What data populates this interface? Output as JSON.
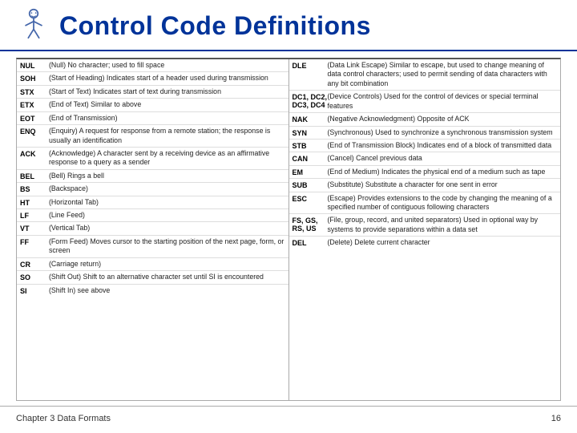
{
  "header": {
    "title": "Control Code Definitions",
    "icon_label": "stick-figure-icon"
  },
  "table": {
    "left_rows": [
      {
        "code": "NUL",
        "desc": "(Null) No character; used to fill space"
      },
      {
        "code": "SOH",
        "desc": "(Start of Heading) Indicates start of a header used during transmission"
      },
      {
        "code": "STX",
        "desc": "(Start of Text) Indicates start of text during transmission"
      },
      {
        "code": "ETX",
        "desc": "(End of Text) Similar to above"
      },
      {
        "code": "EOT",
        "desc": "(End of Transmission)"
      },
      {
        "code": "ENQ",
        "desc": "(Enquiry) A request for response from a remote station; the response is usually an identification"
      },
      {
        "code": "ACK",
        "desc": "(Acknowledge) A character sent by a receiving device as an affirmative response to a query as a sender"
      },
      {
        "code": "BEL",
        "desc": "(Bell) Rings a bell"
      },
      {
        "code": "BS",
        "desc": "(Backspace)"
      },
      {
        "code": "HT",
        "desc": "(Horizontal Tab)"
      },
      {
        "code": "LF",
        "desc": "(Line Feed)"
      },
      {
        "code": "VT",
        "desc": "(Vertical Tab)"
      },
      {
        "code": "FF",
        "desc": "(Form Feed) Moves cursor to the starting position of the next page, form, or screen"
      },
      {
        "code": "CR",
        "desc": "(Carriage return)"
      },
      {
        "code": "SO",
        "desc": "(Shift Out) Shift to an alternative character set until SI is encountered"
      },
      {
        "code": "SI",
        "desc": "(Shift In) see above"
      }
    ],
    "right_rows": [
      {
        "code": "DLE",
        "desc": "(Data Link Escape) Similar to escape, but used to change meaning of data control characters; used to permit sending of data characters with any bit combination"
      },
      {
        "code": "DC1, DC2,\nDC3, DC4",
        "desc": "(Device Controls) Used for the control of devices or special terminal features"
      },
      {
        "code": "NAK",
        "desc": "(Negative Acknowledgment) Opposite of ACK"
      },
      {
        "code": "SYN",
        "desc": "(Synchronous) Used to synchronize a synchronous transmission system"
      },
      {
        "code": "STB",
        "desc": "(End of Transmission Block) Indicates end of a block of transmitted data"
      },
      {
        "code": "CAN",
        "desc": "(Cancel) Cancel previous data"
      },
      {
        "code": "EM",
        "desc": "(End of Medium) Indicates the physical end of a medium such as tape"
      },
      {
        "code": "SUB",
        "desc": "(Substitute) Substitute a character for one sent in error"
      },
      {
        "code": "ESC",
        "desc": "(Escape) Provides extensions to the code by changing the meaning of a specified number of contiguous following characters"
      },
      {
        "code": "FS, GS,\nRS, US",
        "desc": "(File, group, record, and united separators) Used in optional way by systems to provide separations within a data set"
      },
      {
        "code": "DEL",
        "desc": "(Delete) Delete current character"
      }
    ]
  },
  "footer": {
    "chapter": "Chapter 3 Data Formats",
    "page": "16"
  }
}
